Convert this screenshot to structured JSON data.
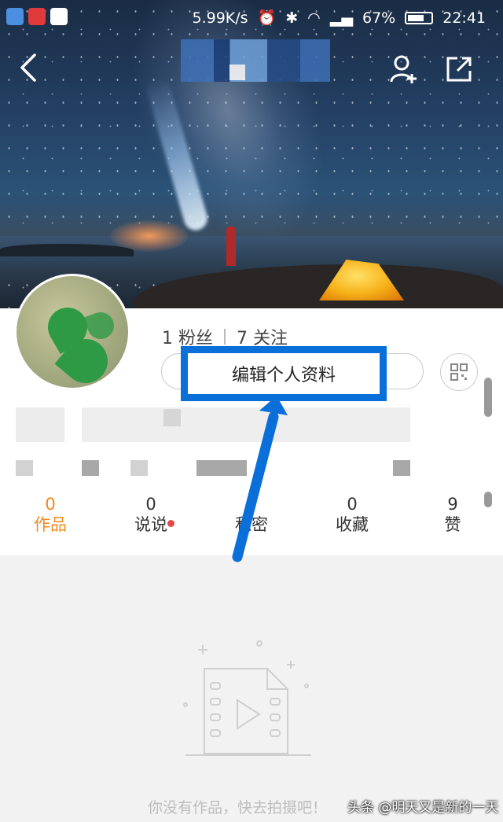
{
  "status_bar": {
    "speed": "5.99K/s",
    "battery": "67%",
    "time": "22:41"
  },
  "profile": {
    "fans": "1 粉丝",
    "following": "7 关注",
    "edit_button": "编辑个人资料"
  },
  "tabs": [
    {
      "count": "0",
      "label": "作品"
    },
    {
      "count": "0",
      "label": "说说"
    },
    {
      "count": "0",
      "label": "私密"
    },
    {
      "count": "0",
      "label": "收藏"
    },
    {
      "count": "9",
      "label": "赞"
    }
  ],
  "empty_message": "你没有作品，快去拍摄吧！",
  "watermark": "头条 @明天又是新的一天",
  "colors": {
    "accent": "#f08a1e",
    "highlight": "#0a6fd8"
  }
}
